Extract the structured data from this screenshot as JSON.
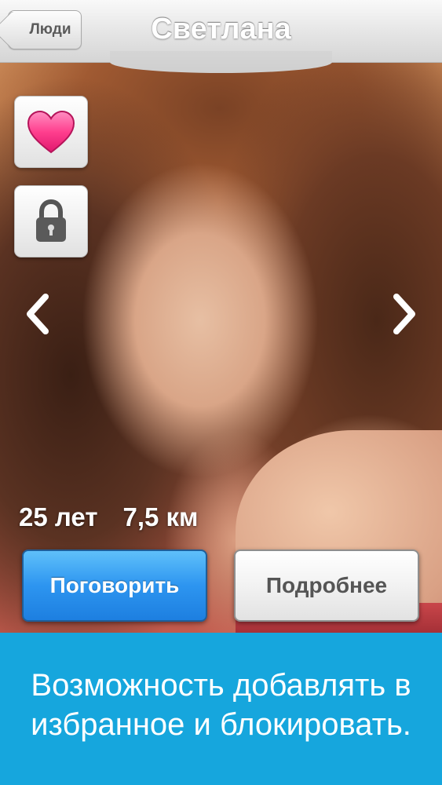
{
  "navbar": {
    "back_label": "Люди",
    "title": "Светлана"
  },
  "profile": {
    "age": "25 лет",
    "distance": "7,5 км",
    "photo_description": ""
  },
  "side_actions": {
    "favorite_icon": "heart-icon",
    "block_icon": "lock-icon"
  },
  "navigation": {
    "prev_icon": "chevron-left-icon",
    "next_icon": "chevron-right-icon"
  },
  "buttons": {
    "talk_label": "Поговорить",
    "more_label": "Подробнее"
  },
  "caption": {
    "line1": "Возможность добавлять в",
    "line2": "избранное и блокировать."
  },
  "colors": {
    "accent_blue": "#16a6dd",
    "heart_pink": "#ff3f8e",
    "talk_button": "#2d95f0"
  }
}
